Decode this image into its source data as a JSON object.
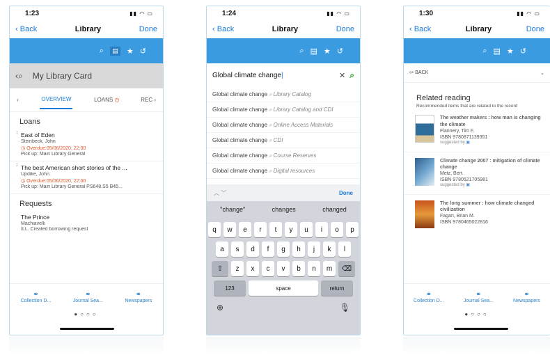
{
  "screens": [
    {
      "time": "1:23",
      "nav": {
        "back": "Back",
        "title": "Library",
        "done": "Done"
      },
      "card_title": "My Library Card",
      "tabs": [
        "OVERVIEW",
        "LOANS",
        "REC"
      ],
      "loans_heading": "Loans",
      "loans": [
        {
          "num": "1",
          "title": "East of Eden",
          "author": "Steinbeck, John",
          "overdue": "Overdue:05/06/2020, 22:00",
          "pickup": "Pick up: Main Library General"
        },
        {
          "num": "2",
          "title": "The best American short stories of the ...",
          "author": "Updike, John.",
          "overdue": "Overdue:05/06/2020, 22:00",
          "pickup": "Pick up: Main Library General PS648.S5 B45..."
        }
      ],
      "requests_heading": "Requests",
      "requests": [
        {
          "title": "The Prince",
          "author": "Machiavelli",
          "status": "ILL. Created borrowing request"
        }
      ],
      "bottom_tabs": [
        "Collection D...",
        "Journal Sea...",
        "Newspapers"
      ]
    },
    {
      "time": "1:24",
      "nav": {
        "back": "Back",
        "title": "Library",
        "done": "Done"
      },
      "search_value": "Global climate change",
      "suggestions": [
        {
          "term": "Global climate change",
          "scope": "Library Catalog"
        },
        {
          "term": "Global climate change",
          "scope": "Library Catalog and CDI"
        },
        {
          "term": "Global climate change",
          "scope": "Online Access Materials"
        },
        {
          "term": "Global climate change",
          "scope": "CDI"
        },
        {
          "term": "Global climate change",
          "scope": "Course Reserves"
        },
        {
          "term": "Global climate change",
          "scope": "Digital resources"
        }
      ],
      "keyboard": {
        "done": "Done",
        "predictions": [
          "\"change\"",
          "changes",
          "changed"
        ],
        "row1": [
          "q",
          "w",
          "e",
          "r",
          "t",
          "y",
          "u",
          "i",
          "o",
          "p"
        ],
        "row2": [
          "a",
          "s",
          "d",
          "f",
          "g",
          "h",
          "j",
          "k",
          "l"
        ],
        "row3": [
          "z",
          "x",
          "c",
          "v",
          "b",
          "n",
          "m"
        ],
        "num_key": "123",
        "space_key": "space",
        "return_key": "return"
      }
    },
    {
      "time": "1:30",
      "nav": {
        "back": "Back",
        "title": "Library",
        "done": "Done"
      },
      "back_label": "BACK",
      "related_heading": "Related reading",
      "related_sub": "Recommended items that are related to the record",
      "books": [
        {
          "title": "The weather makers : how man is changing the climate",
          "author": "Flannery, Tim F.",
          "isbn": "ISBN 9780871139351",
          "suggested": "suggested by"
        },
        {
          "title": "Climate change 2007 : mitigation of climate change",
          "author": "Metz, Bert.",
          "isbn": "ISBN 9780521705981",
          "suggested": "suggested by"
        },
        {
          "title": "The long summer : how climate changed civilization",
          "author": "Fagan, Brian M.",
          "isbn": "ISBN 9780465022816",
          "suggested": ""
        }
      ],
      "bottom_tabs": [
        "Collection D...",
        "Journal Sea...",
        "Newspapers"
      ]
    }
  ]
}
